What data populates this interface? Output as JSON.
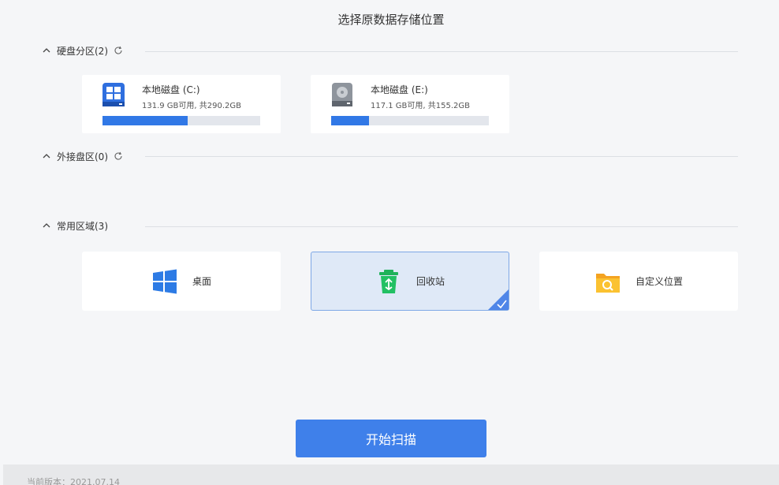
{
  "title": "选择原数据存储位置",
  "sections": {
    "disks": {
      "label": "硬盘分区(2)"
    },
    "external": {
      "label": "外接盘区(0)"
    },
    "common": {
      "label": "常用区域(3)"
    }
  },
  "disks": [
    {
      "name": "本地磁盘 (C:)",
      "size_text": "131.9 GB可用, 共290.2GB",
      "used_fraction": 0.54,
      "icon": "windows-drive-icon"
    },
    {
      "name": "本地磁盘 (E:)",
      "size_text": "117.1 GB可用, 共155.2GB",
      "used_fraction": 0.24,
      "icon": "hard-drive-icon"
    }
  ],
  "locations": [
    {
      "label": "桌面",
      "icon": "windows-logo-icon",
      "selected": false
    },
    {
      "label": "回收站",
      "icon": "recycle-bin-icon",
      "selected": true
    },
    {
      "label": "自定义位置",
      "icon": "folder-search-icon",
      "selected": false
    }
  ],
  "scan_button": "开始扫描",
  "footer": {
    "version": "当前版本：2021.07.14"
  },
  "colors": {
    "accent": "#3f80ea",
    "bar_fill": "#3178e6",
    "selected_bg": "#dfe9f7"
  }
}
